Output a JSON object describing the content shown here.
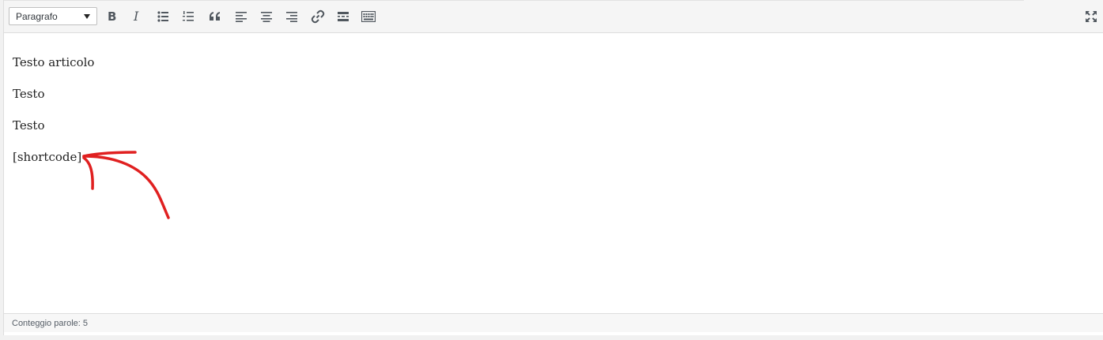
{
  "toolbar": {
    "format_select": {
      "selected": "Paragrafo"
    },
    "buttons": [
      {
        "name": "bold-button",
        "icon": "bold-icon"
      },
      {
        "name": "italic-button",
        "icon": "italic-icon"
      },
      {
        "name": "bullet-list-button",
        "icon": "bullet-list-icon"
      },
      {
        "name": "numbered-list-button",
        "icon": "numbered-list-icon"
      },
      {
        "name": "blockquote-button",
        "icon": "blockquote-icon"
      },
      {
        "name": "align-left-button",
        "icon": "align-left-icon"
      },
      {
        "name": "align-center-button",
        "icon": "align-center-icon"
      },
      {
        "name": "align-right-button",
        "icon": "align-right-icon"
      },
      {
        "name": "link-button",
        "icon": "link-icon"
      },
      {
        "name": "read-more-button",
        "icon": "read-more-icon"
      },
      {
        "name": "toolbar-toggle-button",
        "icon": "keyboard-icon"
      },
      {
        "name": "fullscreen-button",
        "icon": "fullscreen-icon"
      }
    ]
  },
  "content": {
    "paragraphs": [
      "Testo articolo",
      "Testo",
      "Testo",
      "[shortcode]"
    ]
  },
  "annotation": {
    "type": "hand-drawn-arrow",
    "color": "#e02020"
  },
  "statusbar": {
    "word_count": "Conteggio parole: 5"
  }
}
